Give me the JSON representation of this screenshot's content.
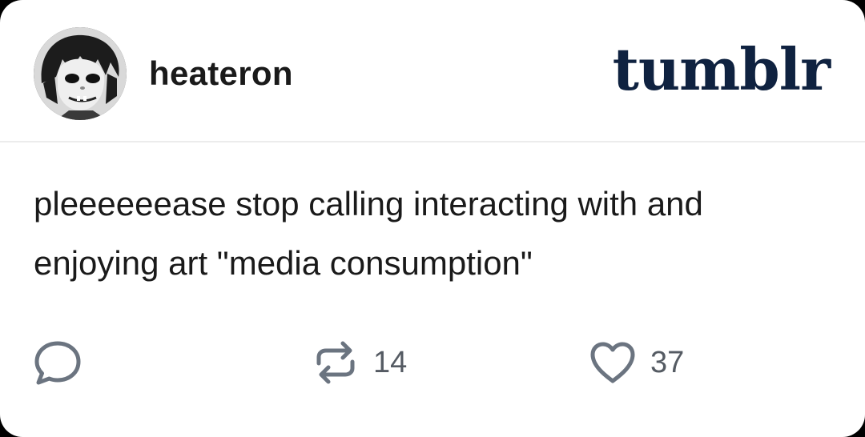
{
  "post": {
    "username": "heateron",
    "platform_logo": "tumblr",
    "text_lines": [
      "pleeeeeease stop calling interacting with and",
      "enjoying art \"media consumption\""
    ]
  },
  "actions": {
    "reply_icon": "speech-bubble-icon",
    "reblog_icon": "reblog-icon",
    "reblog_count": "14",
    "like_icon": "heart-icon",
    "like_count": "37"
  },
  "colors": {
    "logo": "#0f2240",
    "icons": "#6b7480",
    "text": "#1a1a1a"
  }
}
